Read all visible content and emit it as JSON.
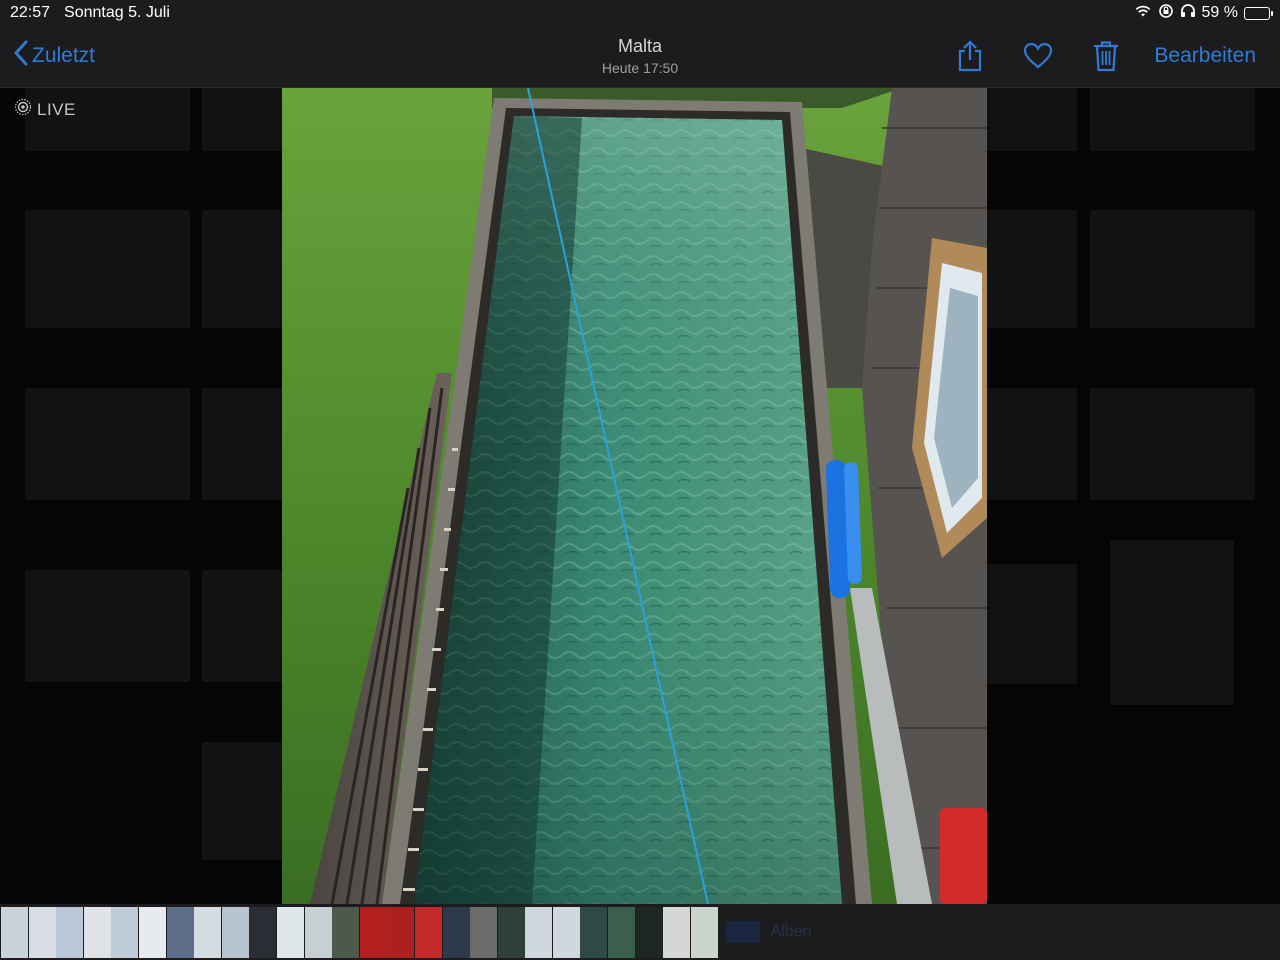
{
  "status_bar": {
    "time": "22:57",
    "date": "Sonntag 5. Juli",
    "battery_text": "59 %",
    "battery_level": 0.59
  },
  "nav": {
    "back_label": "Zuletzt",
    "title": "Malta",
    "subtitle": "Heute  17:50",
    "edit_label": "Bearbeiten",
    "icons": [
      "share-icon",
      "heart-icon",
      "trash-icon"
    ]
  },
  "live_badge": "LIVE",
  "photo": {
    "alt": "Pool",
    "colors": {
      "grass": "#4f8a2c",
      "water": "#2a6d5c",
      "wall": "#4b4b48",
      "float": "#1a73e0"
    }
  },
  "filmstrip": {
    "thumb_colors": [
      "#c9d3dc",
      "#d7dde3",
      "#b9c7d6",
      "#dfe3e7",
      "#c0cbd8",
      "#e8ebee",
      "#5d6f8a",
      "#d5dde3",
      "#b8c4cf",
      "#2a2d33",
      "#dfe6e9",
      "#c6cfd4",
      "#4c5a4d",
      "#b31e1e",
      "#ad2020",
      "#c52a2a",
      "#2d3a4a",
      "#6a6c6a",
      "#2f3f3a",
      "#d0d6dd",
      "#cfd8df",
      "#2f4a45",
      "#3b5f4d",
      "#1e2624",
      "#d4d7d6",
      "#c9d4ca"
    ],
    "albums_label": "Alben"
  },
  "accent_color": "#2f7bd6"
}
